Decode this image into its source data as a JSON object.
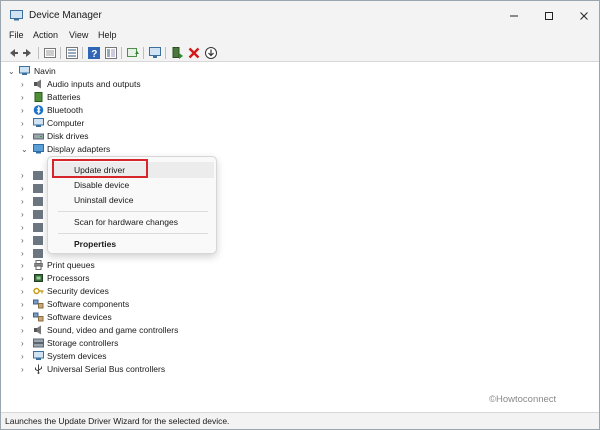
{
  "title": "Device Manager",
  "menu": [
    "File",
    "Action",
    "View",
    "Help"
  ],
  "window_controls": [
    "minimize",
    "maximize",
    "close"
  ],
  "tree": {
    "root": "Navin",
    "items": [
      {
        "label": "Audio inputs and outputs",
        "icon": "speaker-icon",
        "expanded": false
      },
      {
        "label": "Batteries",
        "icon": "battery-icon",
        "expanded": false
      },
      {
        "label": "Bluetooth",
        "icon": "bluetooth-icon",
        "expanded": false
      },
      {
        "label": "Computer",
        "icon": "monitor-icon",
        "expanded": false
      },
      {
        "label": "Disk drives",
        "icon": "disk-icon",
        "expanded": false
      },
      {
        "label": "Display adapters",
        "icon": "display-icon",
        "expanded": true
      },
      {
        "label": "Print queues",
        "icon": "printer-icon",
        "expanded": false
      },
      {
        "label": "Processors",
        "icon": "chip-icon",
        "expanded": false
      },
      {
        "label": "Security devices",
        "icon": "key-icon",
        "expanded": false
      },
      {
        "label": "Software components",
        "icon": "component-icon",
        "expanded": false
      },
      {
        "label": "Software devices",
        "icon": "component-icon",
        "expanded": false
      },
      {
        "label": "Sound, video and game controllers",
        "icon": "speaker-icon",
        "expanded": false
      },
      {
        "label": "Storage controllers",
        "icon": "storage-icon",
        "expanded": false
      },
      {
        "label": "System devices",
        "icon": "monitor-icon",
        "expanded": false
      },
      {
        "label": "Universal Serial Bus controllers",
        "icon": "usb-icon",
        "expanded": false
      }
    ]
  },
  "context_menu": {
    "items": [
      "Update driver",
      "Disable device",
      "Uninstall device",
      "Scan for hardware changes",
      "Properties"
    ],
    "highlighted": "Update driver"
  },
  "status": "Launches the Update Driver Wizard for the selected device.",
  "watermark": "©Howtoconnect",
  "colors": {
    "highlight_border": "#d6252b",
    "chrome": "#f3f3f3",
    "desktop": "#3a5566"
  }
}
